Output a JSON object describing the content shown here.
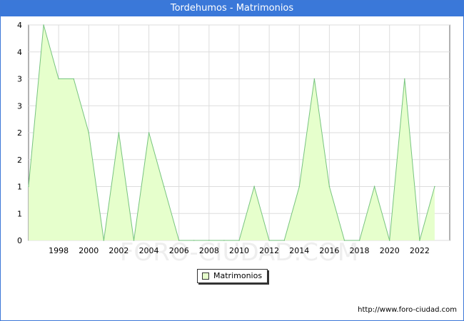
{
  "window": {
    "title": "Tordehumos - Matrimonios"
  },
  "chart_data": {
    "type": "area",
    "title": "Tordehumos - Matrimonios",
    "xlabel": "",
    "ylabel": "",
    "x": [
      1996,
      1997,
      1998,
      1999,
      2000,
      2001,
      2002,
      2003,
      2004,
      2005,
      2006,
      2007,
      2008,
      2009,
      2010,
      2011,
      2012,
      2013,
      2014,
      2015,
      2016,
      2017,
      2018,
      2019,
      2020,
      2021,
      2022,
      2023
    ],
    "series": [
      {
        "name": "Matrimonios",
        "values": [
          1,
          4,
          3,
          3,
          2,
          0,
          2,
          0,
          2,
          1,
          0,
          0,
          0,
          0,
          0,
          1,
          0,
          0,
          1,
          3,
          1,
          0,
          0,
          1,
          0,
          3,
          0,
          1
        ]
      }
    ],
    "xticks": [
      "1998",
      "2000",
      "2002",
      "2004",
      "2006",
      "2008",
      "2010",
      "2012",
      "2014",
      "2016",
      "2018",
      "2020",
      "2022"
    ],
    "xtick_values": [
      1998,
      2000,
      2002,
      2004,
      2006,
      2008,
      2010,
      2012,
      2014,
      2016,
      2018,
      2020,
      2022
    ],
    "yticks": [
      "0",
      "1",
      "1",
      "2",
      "2",
      "3",
      "3",
      "4",
      "4"
    ],
    "ytick_values": [
      0,
      0.5,
      1,
      1.5,
      2,
      2.5,
      3,
      3.5,
      4
    ],
    "xlim": [
      1996,
      2024
    ],
    "ylim": [
      0,
      4
    ],
    "grid": true,
    "legend": "bottom-center",
    "colors": {
      "fill": "#e6ffcc",
      "line": "#77c47f",
      "grid": "#dddddd",
      "title_bar": "#3a78d9"
    }
  },
  "legend": {
    "label": "Matrimonios"
  },
  "watermark": "FORO-CIUDAD.COM",
  "source": "http://www.foro-ciudad.com"
}
